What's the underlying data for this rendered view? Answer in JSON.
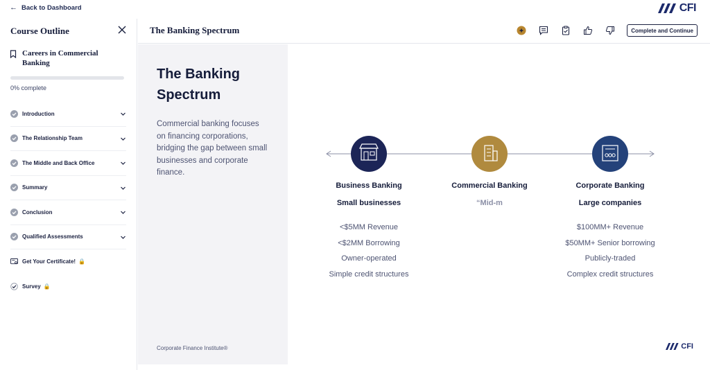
{
  "topbar": {
    "back_label": "Back to Dashboard",
    "logo_text": "CFI"
  },
  "sidebar": {
    "title": "Course Outline",
    "course_title": "Careers in Commercial Banking",
    "progress_label": "0% complete",
    "progress_value": 0,
    "items": [
      {
        "label": "Introduction",
        "type": "section"
      },
      {
        "label": "The Relationship Team",
        "type": "section"
      },
      {
        "label": "The Middle and Back Office",
        "type": "section"
      },
      {
        "label": "Summary",
        "type": "section"
      },
      {
        "label": "Conclusion",
        "type": "section"
      },
      {
        "label": "Qualified Assessments",
        "type": "section"
      },
      {
        "label": "Get Your Certificate!",
        "type": "locked"
      },
      {
        "label": "Survey",
        "type": "locked"
      }
    ]
  },
  "header": {
    "lesson_title": "The Banking Spectrum",
    "complete_label": "Complete and Continue",
    "tool_icons": [
      "bookmark-add-icon",
      "notes-icon",
      "clipboard-icon",
      "thumbs-up-icon",
      "thumbs-down-icon"
    ]
  },
  "slide": {
    "title": "The Banking Spectrum",
    "description": "Commercial banking focuses on financing corporations, bridging the gap between small businesses and corporate finance.",
    "footer": "Corporate Finance Institute®",
    "logo_text": "CFI",
    "columns": [
      {
        "title": "Business Banking",
        "subtitle": "Small businesses",
        "icon": "storefront-icon",
        "color": "#1c2557",
        "items": [
          "<$5MM Revenue",
          "<$2MM Borrowing",
          "Owner-operated",
          "Simple credit structures"
        ]
      },
      {
        "title": "Commercial Banking",
        "subtitle": "“Mid-m",
        "icon": "office-building-icon",
        "color": "#b08a3e",
        "items": []
      },
      {
        "title": "Corporate Banking",
        "subtitle": "Large companies",
        "icon": "skyscraper-icon",
        "color": "#24427a",
        "items": [
          "$100MM+ Revenue",
          "$50MM+ Senior borrowing",
          "Publicly-traded",
          "Complex credit structures"
        ]
      }
    ]
  },
  "colors": {
    "navy": "#1c2a6b",
    "gold": "#b08a3e",
    "accent_tool": "#b8862f"
  }
}
